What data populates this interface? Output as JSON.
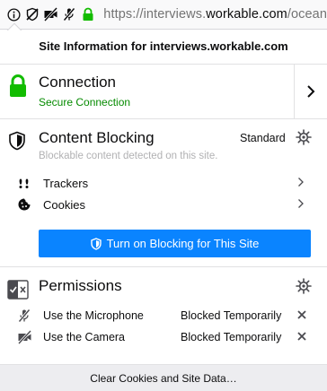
{
  "urlbar": {
    "url_prefix": "https://interviews.",
    "url_domain": "workable.com",
    "url_suffix": "/ocean",
    "icons": [
      "info-icon",
      "tracking-protection-off-icon",
      "camera-blocked-icon",
      "microphone-blocked-icon",
      "lock-icon"
    ]
  },
  "panel": {
    "header": "Site Information for interviews.workable.com",
    "connection": {
      "title": "Connection",
      "status": "Secure Connection",
      "status_color": "#058b00"
    },
    "content_blocking": {
      "title": "Content Blocking",
      "mode": "Standard",
      "subtitle": "Blockable content detected on this site.",
      "items": [
        {
          "label": "Trackers",
          "icon": "trackers-icon"
        },
        {
          "label": "Cookies",
          "icon": "cookie-icon"
        }
      ],
      "button_label": "Turn on Blocking for This Site",
      "button_color": "#0a84ff"
    },
    "permissions": {
      "title": "Permissions",
      "items": [
        {
          "label": "Use the Microphone",
          "state": "Blocked Temporarily",
          "icon": "microphone-blocked-icon"
        },
        {
          "label": "Use the Camera",
          "state": "Blocked Temporarily",
          "icon": "camera-blocked-icon"
        }
      ]
    },
    "footer_button": "Clear Cookies and Site Data…"
  }
}
